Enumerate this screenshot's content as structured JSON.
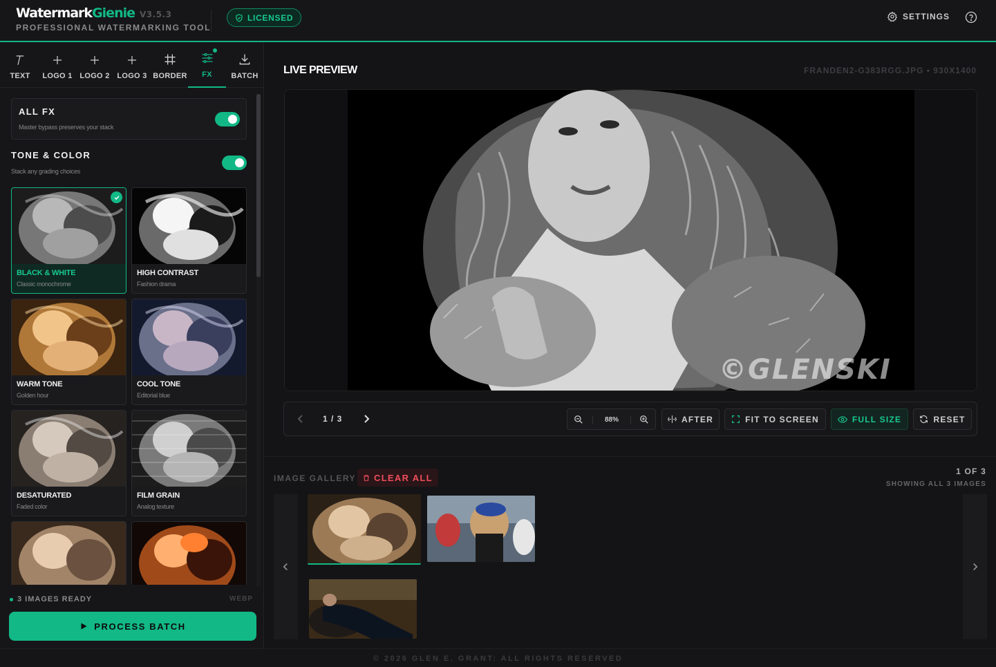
{
  "header": {
    "brand_main": "Watermark",
    "brand_accent": "Gienie",
    "version": "V3.5.3",
    "subtitle": "PROFESSIONAL WATERMARKING TOOL",
    "license_badge": "LICENSED",
    "settings_label": "SETTINGS",
    "help_icon": "help-circle-icon",
    "accent_color": "#12b886"
  },
  "tabs": [
    {
      "label": "TEXT",
      "icon": "text-icon"
    },
    {
      "label": "LOGO 1",
      "icon": "plus-icon"
    },
    {
      "label": "LOGO 2",
      "icon": "plus-icon"
    },
    {
      "label": "LOGO 3",
      "icon": "plus-icon"
    },
    {
      "label": "BORDER",
      "icon": "border-icon"
    },
    {
      "label": "FX",
      "icon": "sliders-icon",
      "active": true
    },
    {
      "label": "BATCH",
      "icon": "download-icon"
    }
  ],
  "fx": {
    "all_fx_title": "ALL FX",
    "all_fx_desc": "Master bypass preserves your stack",
    "all_fx_on": true,
    "section_title": "TONE & COLOR",
    "section_desc": "Stack any grading choices",
    "section_on": true,
    "presets": [
      {
        "name": "BLACK & WHITE",
        "desc": "Classic monochrome",
        "selected": true
      },
      {
        "name": "HIGH CONTRAST",
        "desc": "Fashion drama"
      },
      {
        "name": "WARM TONE",
        "desc": "Golden hour"
      },
      {
        "name": "COOL TONE",
        "desc": "Editorial blue"
      },
      {
        "name": "DESATURATED",
        "desc": "Faded color"
      },
      {
        "name": "FILM GRAIN",
        "desc": "Analog texture"
      }
    ]
  },
  "left_footer": {
    "ready_text": "3 IMAGES READY",
    "format": "WEBP",
    "process_label": "PROCESS BATCH"
  },
  "preview": {
    "title": "LIVE PREVIEW",
    "file_info": "FRANDEN2-G383RGG.JPG • 930X1400",
    "watermark_text": "©GLENSKI"
  },
  "controls": {
    "page": "1 / 3",
    "zoom": "88%",
    "after_label": "AFTER",
    "fit_label": "FIT TO SCREEN",
    "full_label": "FULL SIZE",
    "reset_label": "RESET"
  },
  "gallery": {
    "title": "IMAGE GALLERY",
    "clear_label": "CLEAR ALL",
    "count": "1 OF 3",
    "showing": "SHOWING ALL 3 IMAGES"
  },
  "footer": {
    "copyright": "© 2026 GLEN E. GRANT: ALL RIGHTS RESERVED"
  }
}
